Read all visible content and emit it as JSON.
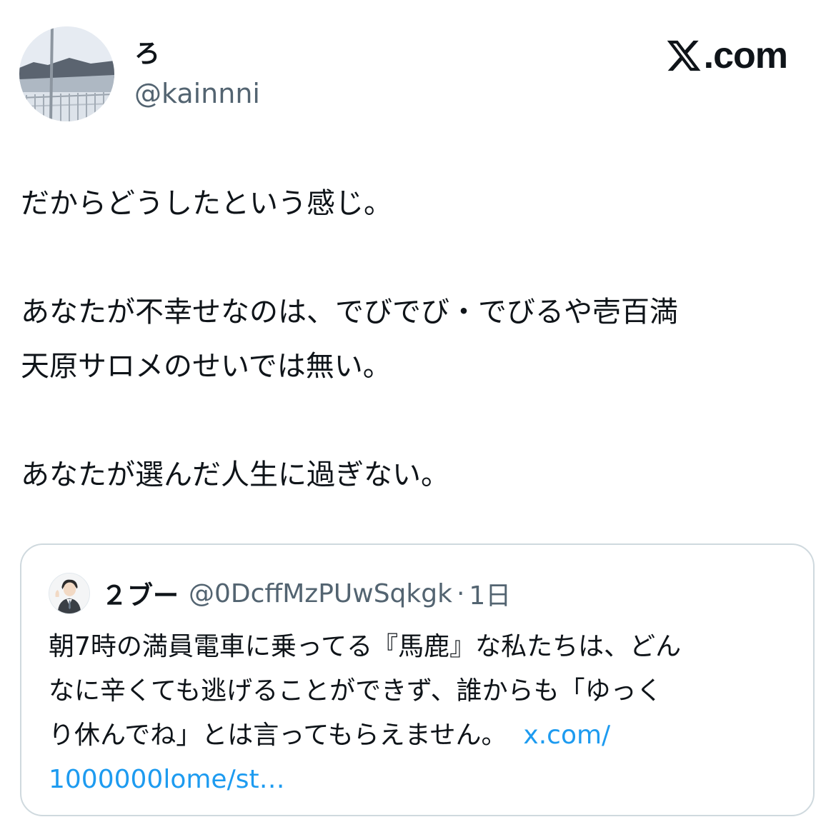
{
  "author": {
    "display_name": "ろ",
    "handle": "@kainnni",
    "avatar_icon": "landscape-photo-avatar"
  },
  "brand": {
    "logo_icon": "x-logo-icon",
    "text": ".com"
  },
  "tweet": {
    "paragraphs": [
      [
        "だからどうしたという感じ。"
      ],
      [
        "あなたが不幸せなのは、でびでび・でびるや壱百満",
        "天原サロメのせいでは無い。"
      ],
      [
        "あなたが選んだ人生に過ぎない。"
      ]
    ]
  },
  "quoted_tweet": {
    "display_name": "２ブー",
    "handle": "@0DcffMzPUwSqkgk",
    "separator": "·",
    "time": "1日",
    "avatar_icon": "illustrated-person-avatar",
    "lines": [
      "朝7時の満員電車に乗ってる『馬鹿』な私たちは、どん",
      "なに辛くても逃げることができず、誰からも「ゆっく",
      "り休んでね」とは言ってもらえません。"
    ],
    "link_part1": "x.com/",
    "link_part2": "1000000lome/st…"
  },
  "colors": {
    "text": "#0f1419",
    "secondary": "#536471",
    "link": "#1d9bf0",
    "border": "#cfd9de"
  }
}
